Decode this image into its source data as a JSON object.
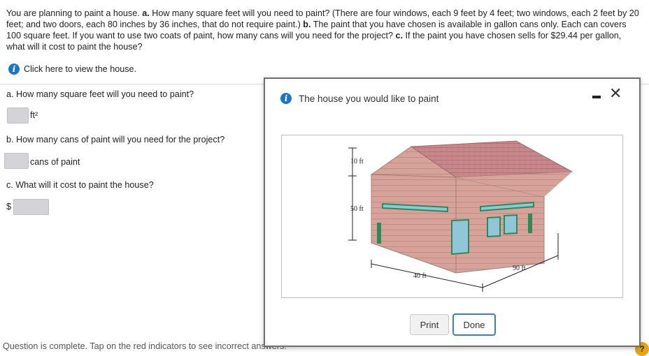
{
  "question": {
    "p1": "You are planning to paint a house. ",
    "a_label": "a.",
    "p2": " How many square feet will you need to paint? (There are four windows, each 9 feet by 4 feet; two windows, each 2 feet by 20 feet; and two doors, each 80 inches by 36 inches, that do not require paint.) ",
    "b_label": "b.",
    "p3": " The paint that you have chosen is available in gallon cans only. Each can covers 100 square feet. If you want to use two coats of paint, how many cans will you need for the project? ",
    "c_label": "c.",
    "p4": " If the paint you have chosen sells for $29.44 per gallon, what will it cost to paint the house?"
  },
  "help_link": "Click here to view the house.",
  "info_glyph": "i",
  "part_a": {
    "prompt": "a. How many square feet will you need to paint?",
    "unit": "ft²"
  },
  "part_b": {
    "prompt": "b. How many cans of paint will you need for the project?",
    "unit": "cans of paint"
  },
  "part_c": {
    "prompt": "c. What will it cost to paint the house?",
    "prefix": "$"
  },
  "footer": "Question is complete. Tap on the red indicators to see incorrect answers.",
  "help_badge": "?",
  "modal": {
    "title": "The house you would like to paint",
    "close": "✕",
    "print_label": "Print",
    "done_label": "Done",
    "figure": {
      "roof_height": "10 ft",
      "wall_height": "50 ft",
      "front_width": "40 ft",
      "side_length": "90 ft"
    }
  },
  "colors": {
    "wall": "#d7a29a",
    "roof": "#c8878a",
    "trim": "#2f8a55",
    "window_glass": "#8fc6d8",
    "info_blue": "#1a75c9",
    "done_border": "#3d7cc9"
  }
}
